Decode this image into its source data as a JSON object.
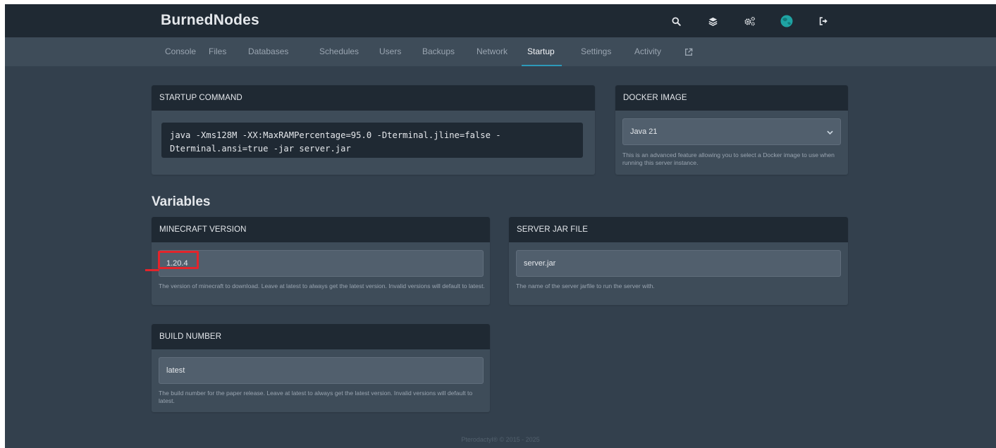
{
  "brand": "BurnedNodes",
  "top_icons": [
    "search-icon",
    "layers-icon",
    "cogs-icon",
    "avatar",
    "sign-out-icon"
  ],
  "tabs": [
    {
      "label": "Console"
    },
    {
      "label": "Files"
    },
    {
      "label": "Databases"
    },
    {
      "label": "Schedules"
    },
    {
      "label": "Users"
    },
    {
      "label": "Backups"
    },
    {
      "label": "Network"
    },
    {
      "label": "Startup",
      "active": true
    },
    {
      "label": "Settings"
    },
    {
      "label": "Activity"
    }
  ],
  "startup": {
    "title": "STARTUP COMMAND",
    "command": "java -Xms128M -XX:MaxRAMPercentage=95.0 -Dterminal.jline=false -Dterminal.ansi=true -jar server.jar"
  },
  "docker": {
    "title": "DOCKER IMAGE",
    "selected": "Java 21",
    "help": "This is an advanced feature allowing you to select a Docker image to use when running this server instance."
  },
  "variables_title": "Variables",
  "variables": {
    "minecraft_version": {
      "title": "MINECRAFT VERSION",
      "value": "1.20.4",
      "help": "The version of minecraft to download. Leave at latest to always get the latest version. Invalid versions will default to latest."
    },
    "server_jar": {
      "title": "SERVER JAR FILE",
      "value": "server.jar",
      "help": "The name of the server jarfile to run the server with."
    },
    "build_number": {
      "title": "BUILD NUMBER",
      "value": "latest",
      "help": "The build number for the paper release. Leave at latest to always get the latest version. Invalid versions will default to latest."
    }
  },
  "footer": "Pterodactyl® © 2015 - 2025",
  "colors": {
    "accent": "#2d99b9",
    "annotation": "#e3242b",
    "avatar": "#1fa3a3"
  }
}
